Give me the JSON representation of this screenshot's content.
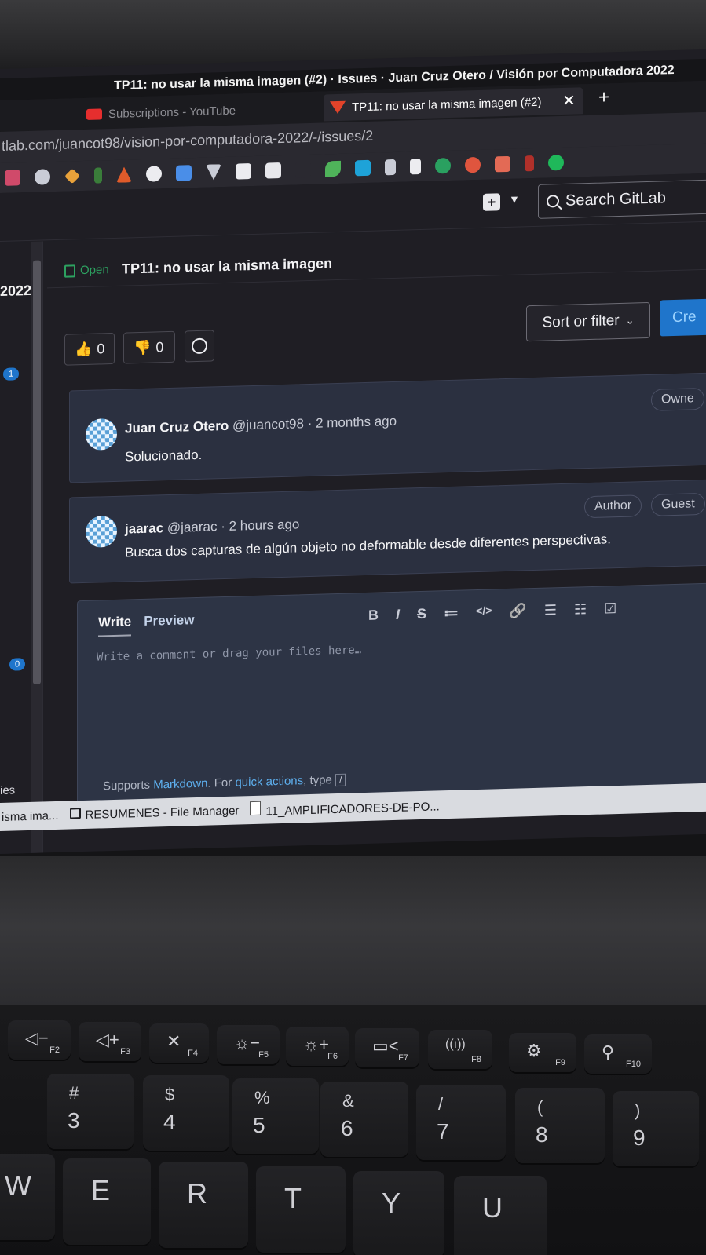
{
  "browser": {
    "window_title": "TP11: no usar la misma imagen (#2) · Issues · Juan Cruz Otero / Visión por Computadora 2022",
    "tabs": [
      {
        "label": "Subscriptions - YouTube",
        "icon": "youtube-icon"
      },
      {
        "label": "TP11: no usar la misma imagen (#2)",
        "icon": "gitlab-icon",
        "active": true
      }
    ],
    "url": "tlab.com/juancot98/vision-por-computadora-2022/-/issues/2"
  },
  "gitlab": {
    "search_placeholder": "Search GitLab",
    "sidebar": {
      "project_fragment": "2022",
      "badge_a": "1",
      "badge_b": "0",
      "item_fragment": "ies"
    },
    "issue": {
      "status": "Open",
      "title": "TP11: no usar la misma imagen",
      "thumbs_up": "0",
      "thumbs_down": "0",
      "sort_label": "Sort or filter",
      "create_label": "Cre"
    },
    "notes": [
      {
        "author": "Juan Cruz Otero",
        "handle": "@juancot98 · 2 months ago",
        "body": "Solucionado.",
        "badges": [
          "Owne"
        ]
      },
      {
        "author": "jaarac",
        "handle": "@jaarac · 2 hours ago",
        "body": "Busca dos capturas de algún objeto no deformable desde diferentes perspectivas.",
        "badges": [
          "Author",
          "Guest"
        ]
      }
    ],
    "editor": {
      "tab_write": "Write",
      "tab_preview": "Preview",
      "toolbar": [
        "B",
        "I",
        "S",
        "≔",
        "</>",
        "🔗",
        "☰",
        "☷",
        "☑"
      ],
      "placeholder": "Write a comment or drag your files here…",
      "help_prefix": "Supports",
      "help_markdown": "Markdown",
      "help_mid": ". For",
      "help_quick": "quick actions",
      "help_suffix": ", type",
      "help_key": "/"
    }
  },
  "taskbar": [
    {
      "label": "isma ima...",
      "icon": "none"
    },
    {
      "label": "RESUMENES - File Manager",
      "icon": "folder-icon"
    },
    {
      "label": "11_AMPLIFICADORES-DE-PO...",
      "icon": "document-icon"
    }
  ],
  "keyboard": {
    "fn_keys": [
      {
        "sym": "◁−",
        "label": "F2"
      },
      {
        "sym": "◁+",
        "label": "F3"
      },
      {
        "sym": "✕",
        "label": "F4"
      },
      {
        "sym": "☼−",
        "label": "F5"
      },
      {
        "sym": "☼+",
        "label": "F6"
      },
      {
        "sym": "▭<",
        "label": "F7"
      },
      {
        "sym": "((ı))",
        "label": "F8"
      },
      {
        "sym": "⚙",
        "label": "F9"
      },
      {
        "sym": "⚲",
        "label": "F10"
      }
    ],
    "num_keys": [
      {
        "top": "#",
        "bot": "3"
      },
      {
        "top": "$",
        "bot": "4"
      },
      {
        "top": "%",
        "bot": "5"
      },
      {
        "top": "&",
        "bot": "6"
      },
      {
        "top": "/",
        "bot": "7"
      },
      {
        "top": "(",
        "bot": "8"
      },
      {
        "top": ")",
        "bot": "9"
      }
    ],
    "letter_keys": [
      "W",
      "E",
      "R",
      "T",
      "Y",
      "U"
    ]
  },
  "colors": {
    "accent_blue": "#1f75cb",
    "open_green": "#2da160",
    "link": "#5eb0ef"
  }
}
